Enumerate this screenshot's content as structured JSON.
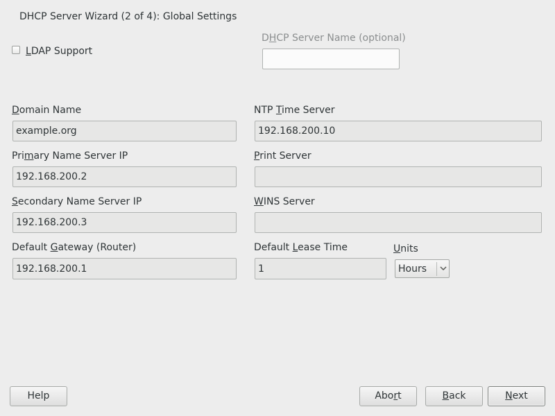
{
  "window": {
    "title": "DHCP Server Wizard (2 of 4): Global Settings"
  },
  "ldap": {
    "label_pre": "",
    "label_key": "L",
    "label_post": "DAP Support",
    "checked": false
  },
  "server_name": {
    "label_pre": "D",
    "label_key": "H",
    "label_post": "CP Server Name (optional)",
    "value": ""
  },
  "domain_name": {
    "label_pre": "",
    "label_key": "D",
    "label_post": "omain Name",
    "value": "example.org"
  },
  "primary_ns": {
    "label_pre": "Pri",
    "label_key": "m",
    "label_post": "ary Name Server IP",
    "value": "192.168.200.2"
  },
  "secondary_ns": {
    "label_pre": "",
    "label_key": "S",
    "label_post": "econdary Name Server IP",
    "value": "192.168.200.3"
  },
  "gateway": {
    "label_pre": "Default ",
    "label_key": "G",
    "label_post": "ateway (Router)",
    "value": "192.168.200.1"
  },
  "ntp": {
    "label_pre": "NTP ",
    "label_key": "T",
    "label_post": "ime Server",
    "value": "192.168.200.10"
  },
  "print_server": {
    "label_pre": "",
    "label_key": "P",
    "label_post": "rint Server",
    "value": ""
  },
  "wins": {
    "label_pre": "",
    "label_key": "W",
    "label_post": "INS Server",
    "value": ""
  },
  "lease_time": {
    "label_pre": "Default ",
    "label_key": "L",
    "label_post": "ease Time",
    "value": "1"
  },
  "units": {
    "label_pre": "",
    "label_key": "U",
    "label_post": "nits",
    "selected": "Hours"
  },
  "buttons": {
    "help": "Help",
    "abort_pre": "Abo",
    "abort_key": "r",
    "abort_post": "t",
    "back_pre": "",
    "back_key": "B",
    "back_post": "ack",
    "next_pre": "",
    "next_key": "N",
    "next_post": "ext"
  }
}
